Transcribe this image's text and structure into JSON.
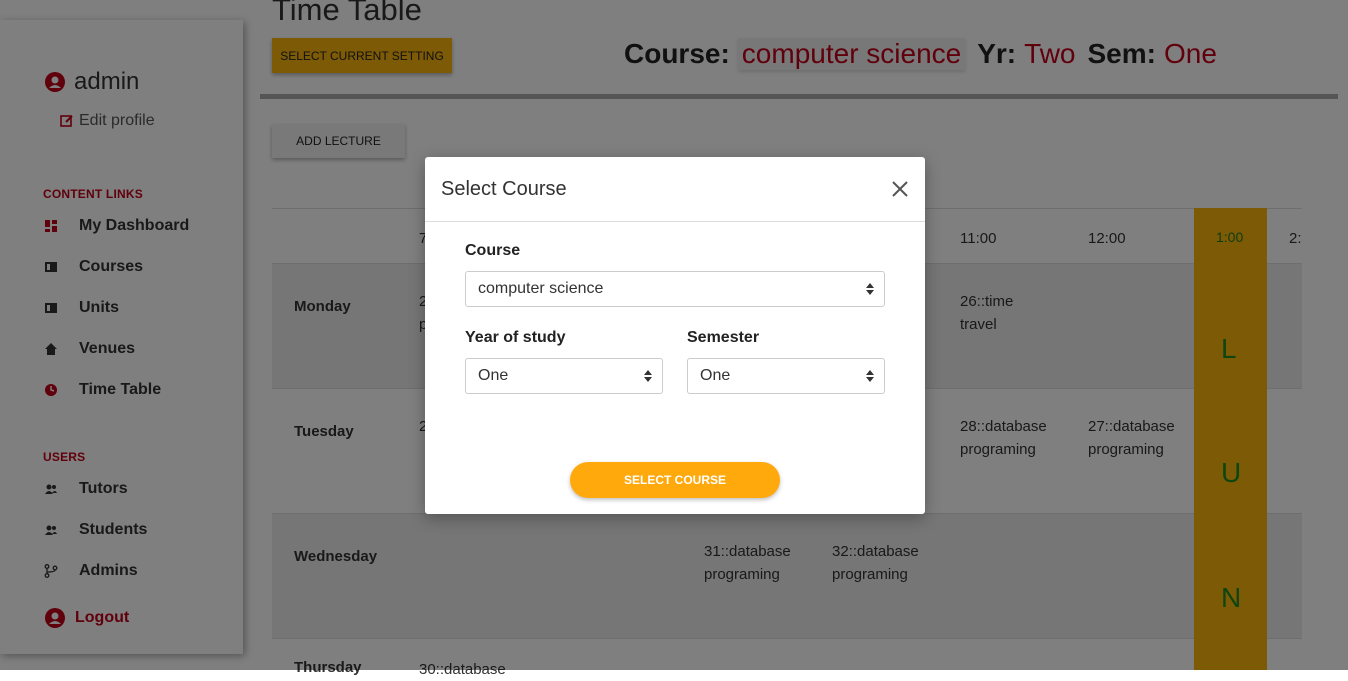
{
  "sidebar": {
    "username": "admin",
    "edit_profile": "Edit profile",
    "content_links_label": "CONTENT LINKS",
    "content_links": [
      {
        "label": "My Dashboard",
        "icon": "dashboard-icon"
      },
      {
        "label": "Courses",
        "icon": "book-icon"
      },
      {
        "label": "Units",
        "icon": "book-icon"
      },
      {
        "label": "Venues",
        "icon": "home-icon"
      },
      {
        "label": "Time Table",
        "icon": "clock-icon"
      }
    ],
    "users_label": "USERS",
    "user_links": [
      {
        "label": "Tutors",
        "icon": "users-icon"
      },
      {
        "label": "Students",
        "icon": "users-icon"
      },
      {
        "label": "Admins",
        "icon": "branch-icon"
      }
    ],
    "logout": "Logout"
  },
  "main": {
    "title": "Time Table",
    "select_setting_button": "SELECT CURRENT SETTING",
    "course_label": "Course:",
    "course_value": "computer science",
    "year_label": "Yr:",
    "year_value": "Two",
    "sem_label": "Sem:",
    "sem_value": "One",
    "add_lecture_button": "ADD LECTURE"
  },
  "timetable": {
    "times": [
      "7",
      "11:00",
      "12:00",
      "1:00",
      "2:"
    ],
    "lunch_letters": [
      "L",
      "U",
      "N"
    ],
    "rows": [
      {
        "day": "Monday",
        "cells": [
          "2\np",
          "26::time\ntravel"
        ]
      },
      {
        "day": "Tuesday",
        "cells": [
          "2",
          "28::database\nprograming",
          "27::database\nprograming"
        ]
      },
      {
        "day": "Wednesday",
        "cells": [
          "31::database\nprograming",
          "32::database\nprograming"
        ]
      },
      {
        "day": "Thursday",
        "cells": [
          "30::database"
        ]
      }
    ]
  },
  "modal": {
    "title": "Select Course",
    "course_label": "Course",
    "course_value": "computer science",
    "year_label": "Year of study",
    "year_value": "One",
    "semester_label": "Semester",
    "semester_value": "One",
    "submit_button": "SELECT COURSE"
  },
  "colors": {
    "accent_red": "#c2001a",
    "accent_orange": "#fbb40a",
    "button_orange": "#ffa90d",
    "lunch_green": "#1f8a1f"
  }
}
